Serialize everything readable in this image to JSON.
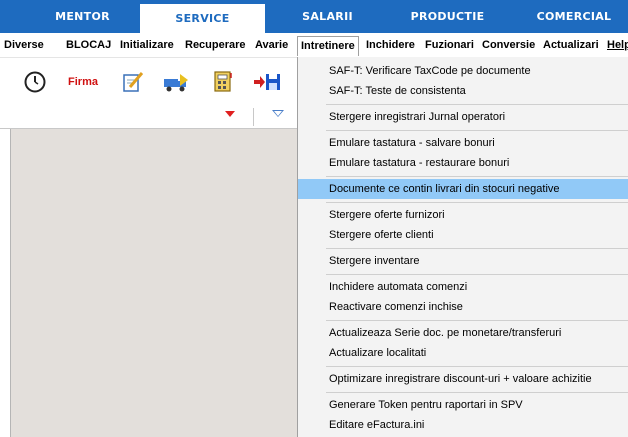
{
  "tabs": [
    "MENTOR",
    "SERVICE",
    "SALARII",
    "PRODUCTIE",
    "COMERCIAL"
  ],
  "menubar": [
    "Diverse",
    "BLOCAJ",
    "Initializare",
    "Recuperare",
    "Avarie",
    "Intretinere",
    "Inchidere",
    "Fuzionari",
    "Conversie",
    "Actualizari",
    "Help"
  ],
  "toolbar": {
    "firma_label": "Firma"
  },
  "dropdown": {
    "items": [
      "SAF-T: Verificare TaxCode pe documente",
      "SAF-T: Teste de consistenta",
      "Stergere inregistrari Jurnal operatori",
      "Emulare tastatura - salvare bonuri",
      "Emulare tastatura - restaurare bonuri",
      "Documente ce contin livrari din stocuri negative",
      "Stergere oferte furnizori",
      "Stergere oferte clienti",
      "Stergere inventare",
      "Inchidere automata comenzi",
      "Reactivare comenzi inchise",
      "Actualizeaza Serie doc. pe monetare/transferuri",
      "Actualizare localitati",
      "Optimizare inregistrare discount-uri + valoare achizitie",
      "Generare Token pentru raportari in SPV",
      "Editare eFactura.ini"
    ],
    "highlighted": "Documente ce contin livrari din stocuri negative"
  },
  "colors": {
    "tab_bar": "#1e6bbf",
    "highlight": "#91c9f7",
    "workspace": "#e3dfdb"
  }
}
